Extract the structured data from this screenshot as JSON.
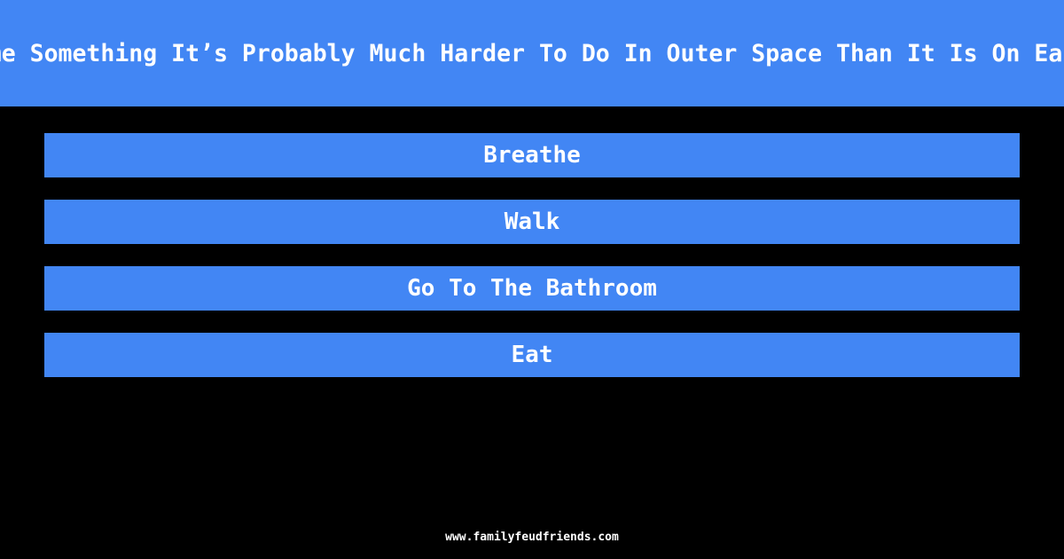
{
  "question": "Name Something It’s Probably Much Harder To Do In Outer Space Than It Is On Earth",
  "answers": [
    {
      "label": "Breathe"
    },
    {
      "label": "Walk"
    },
    {
      "label": "Go To The Bathroom"
    },
    {
      "label": "Eat"
    }
  ],
  "footer": {
    "site": "www.familyfeudfriends.com"
  },
  "colors": {
    "accent": "#4286f4",
    "background": "#000000",
    "text": "#ffffff"
  }
}
